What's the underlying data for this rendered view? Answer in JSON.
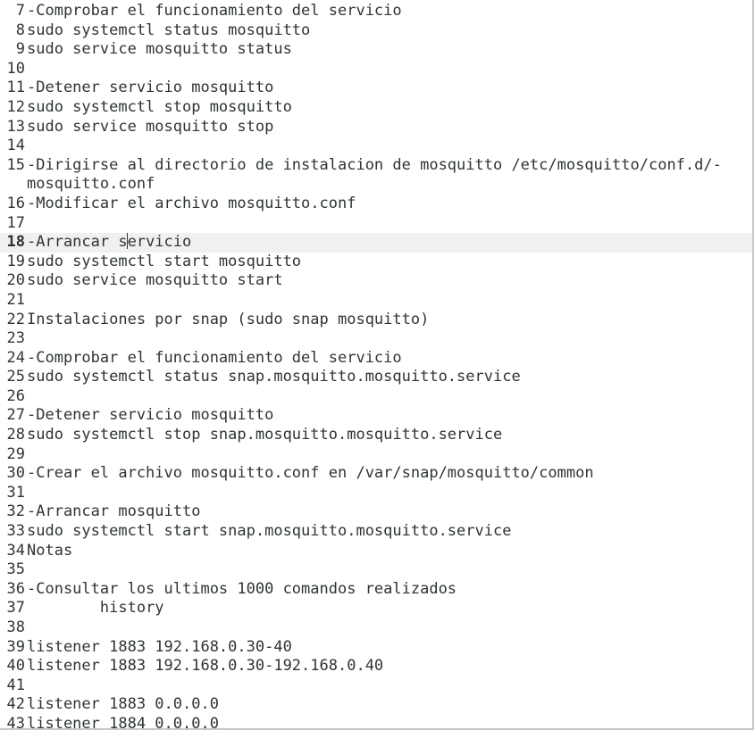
{
  "editor": {
    "current_line": "18",
    "lines": [
      {
        "num": "7",
        "text": "-Comprobar el funcionamiento del servicio"
      },
      {
        "num": "8",
        "text": "sudo systemctl status mosquitto"
      },
      {
        "num": "9",
        "text": "sudo service mosquitto status"
      },
      {
        "num": "10",
        "text": ""
      },
      {
        "num": "11",
        "text": "-Detener servicio mosquitto"
      },
      {
        "num": "12",
        "text": "sudo systemctl stop mosquitto"
      },
      {
        "num": "13",
        "text": "sudo service mosquitto stop"
      },
      {
        "num": "14",
        "text": ""
      },
      {
        "num": "15",
        "text": "-Dirigirse al directorio de instalacion de mosquitto /etc/mosquitto/conf.d/-\nmosquitto.conf"
      },
      {
        "num": "16",
        "text": "-Modificar el archivo mosquitto.conf"
      },
      {
        "num": "17",
        "text": ""
      },
      {
        "num": "18",
        "text_before_caret": "-Arrancar s",
        "text_after_caret": "ervicio"
      },
      {
        "num": "19",
        "text": "sudo systemctl start mosquitto"
      },
      {
        "num": "20",
        "text": "sudo service mosquitto start"
      },
      {
        "num": "21",
        "text": ""
      },
      {
        "num": "22",
        "text": "Instalaciones por snap (sudo snap mosquitto)"
      },
      {
        "num": "23",
        "text": ""
      },
      {
        "num": "24",
        "text": "-Comprobar el funcionamiento del servicio"
      },
      {
        "num": "25",
        "text": "sudo systemctl status snap.mosquitto.mosquitto.service"
      },
      {
        "num": "26",
        "text": ""
      },
      {
        "num": "27",
        "text": "-Detener servicio mosquitto"
      },
      {
        "num": "28",
        "text": "sudo systemctl stop snap.mosquitto.mosquitto.service"
      },
      {
        "num": "29",
        "text": ""
      },
      {
        "num": "30",
        "text": "-Crear el archivo mosquitto.conf en /var/snap/mosquitto/common"
      },
      {
        "num": "31",
        "text": ""
      },
      {
        "num": "32",
        "text": "-Arrancar mosquitto"
      },
      {
        "num": "33",
        "text": "sudo systemctl start snap.mosquitto.mosquitto.service"
      },
      {
        "num": "34",
        "text": "Notas"
      },
      {
        "num": "35",
        "text": ""
      },
      {
        "num": "36",
        "text": "-Consultar los ultimos 1000 comandos realizados"
      },
      {
        "num": "37",
        "text": "        history"
      },
      {
        "num": "38",
        "text": ""
      },
      {
        "num": "39",
        "text": "listener 1883 192.168.0.30-40"
      },
      {
        "num": "40",
        "text": "listener 1883 192.168.0.30-192.168.0.40"
      },
      {
        "num": "41",
        "text": ""
      },
      {
        "num": "42",
        "text": "listener 1883 0.0.0.0"
      },
      {
        "num": "43",
        "text": "listener 1884 0.0.0.0"
      }
    ]
  }
}
